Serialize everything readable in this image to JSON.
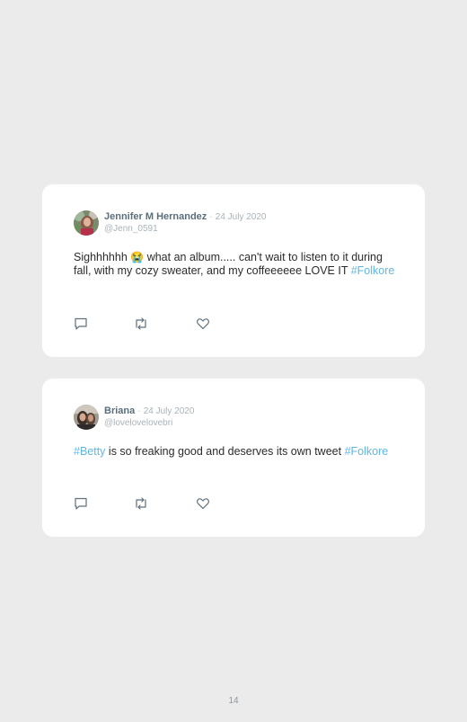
{
  "tweets": [
    {
      "name": "Jennifer M Hernandez",
      "separator": "·",
      "date": "24 July 2020",
      "handle": "@Jenn_0591",
      "text_before": "Sighhhhhh ",
      "emoji": "😭",
      "text_after": " what an album..... can't wait to listen to it during fall, with my cozy sweater, and my coffeeeeee LOVE IT ",
      "hashtag": "#Folkore"
    },
    {
      "name": "Briana",
      "separator": "·",
      "date": "24 July 2020",
      "handle": "@lovelovelovebri",
      "hashtag1": "#Betty",
      "text": " is so freaking good and deserves its own tweet ",
      "hashtag2": "#Folkore"
    }
  ],
  "icons": [
    "avatar",
    "reply-icon",
    "retweet-icon",
    "like-icon"
  ],
  "colors": {
    "background": "#ebebeb",
    "card": "#ffffff",
    "hashtag": "#62b6e3",
    "name": "#5a6e7b",
    "meta": "#a7b3ba"
  },
  "page_number": "14"
}
